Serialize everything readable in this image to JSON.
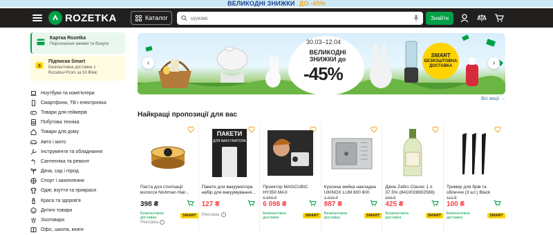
{
  "promo_bar": {
    "text": "ВЕЛИКОДНІ ЗНИЖКИ",
    "highlight": "ДО -45%"
  },
  "header": {
    "logo": "ROZETKA",
    "catalog_label": "Каталог",
    "search_placeholder": "шукаю",
    "search_button": "Знайти",
    "icons": [
      "user-icon",
      "compare-icon",
      "cart-icon"
    ]
  },
  "sidebar": {
    "cards": [
      {
        "title": "Картка Rozetka",
        "subtitle": "Персональні знижки та бонуси"
      },
      {
        "title": "Підписка Smart",
        "subtitle": "Безкоштовна доставка з Rozetka+Prom за 50 ₴/міс"
      }
    ],
    "items": [
      {
        "label": "Ноутбуки та комп'ютери",
        "icon": "laptop-icon"
      },
      {
        "label": "Смартфони, ТВ і електроніка",
        "icon": "smartphone-icon"
      },
      {
        "label": "Товари для геймерів",
        "icon": "gamepad-icon"
      },
      {
        "label": "Побутова техніка",
        "icon": "appliance-icon"
      },
      {
        "label": "Товари для дому",
        "icon": "home-icon"
      },
      {
        "label": "Авто і мото",
        "icon": "car-icon"
      },
      {
        "label": "Інструменти та обладнання",
        "icon": "tools-icon"
      },
      {
        "label": "Сантехніка та ремонт",
        "icon": "faucet-icon"
      },
      {
        "label": "Дача, сад і город",
        "icon": "garden-icon"
      },
      {
        "label": "Спорт і захоплення",
        "icon": "sport-icon"
      },
      {
        "label": "Одяг, взуття та прикраси",
        "icon": "clothes-icon"
      },
      {
        "label": "Краса та здоров'я",
        "icon": "beauty-icon"
      },
      {
        "label": "Дитячі товари",
        "icon": "kids-icon"
      },
      {
        "label": "Зоотовари",
        "icon": "pet-icon"
      },
      {
        "label": "Офіс, школа, книги",
        "icon": "book-icon"
      }
    ]
  },
  "banner": {
    "dates": "30.03–12.04",
    "title": "ВЕЛИКОДНІ ЗНИЖКИ до",
    "percent": "-45%",
    "smart_label": "SMART",
    "smart_text": "БЕЗКОШТОВНА ДОСТАВКА"
  },
  "all_promos": "Всі акції →",
  "section_title": "Найкращі пропозиції для вас",
  "products": [
    {
      "name": "Паста для стилізації волосся Nishman Hair...",
      "old_price": "",
      "price": "398 ₴",
      "sale": false,
      "free_delivery": "Безкоштовна доставка",
      "smart": "SMART",
      "ads": "Реклама"
    },
    {
      "name": "Пакети для вакууматора набір для вакуумування...",
      "old_price": "",
      "price": "127 ₴",
      "sale": true,
      "free_delivery": "",
      "smart": "",
      "ads": "Реклама"
    },
    {
      "name": "Проектор MAGCUBIC HY350 MAX портативний...",
      "old_price": "6 999 ₴",
      "price": "6 098 ₴",
      "sale": true,
      "free_delivery": "Безкоштовна доставка",
      "smart": "SMART",
      "ads": ""
    },
    {
      "name": "Кухонна мийка накладна UKINOX LUM 800 600 5C...",
      "old_price": "1 306 ₴",
      "price": "887 ₴",
      "sale": true,
      "free_delivery": "Безкоштовна доставка",
      "smart": "SMART",
      "ads": ""
    },
    {
      "name": "Джин Zafiro Classic 1 л 37.5% (8410028902569)",
      "old_price": "588 ₴",
      "price": "425 ₴",
      "sale": true,
      "free_delivery": "Безкоштовна доставка",
      "smart": "SMART",
      "ads": ""
    },
    {
      "name": "Тример для брів та обличчя (3 шт.) Black",
      "old_price": "110 ₴",
      "price": "100 ₴",
      "sale": true,
      "free_delivery": "Безкоштовна доставка",
      "smart": "SMART",
      "ads": ""
    }
  ],
  "colors": {
    "header_bg": "#221f1f",
    "accent_green": "#00a046",
    "sale_red": "#f84147",
    "smart_yellow": "#ffd400",
    "link_blue": "#3e77aa"
  }
}
